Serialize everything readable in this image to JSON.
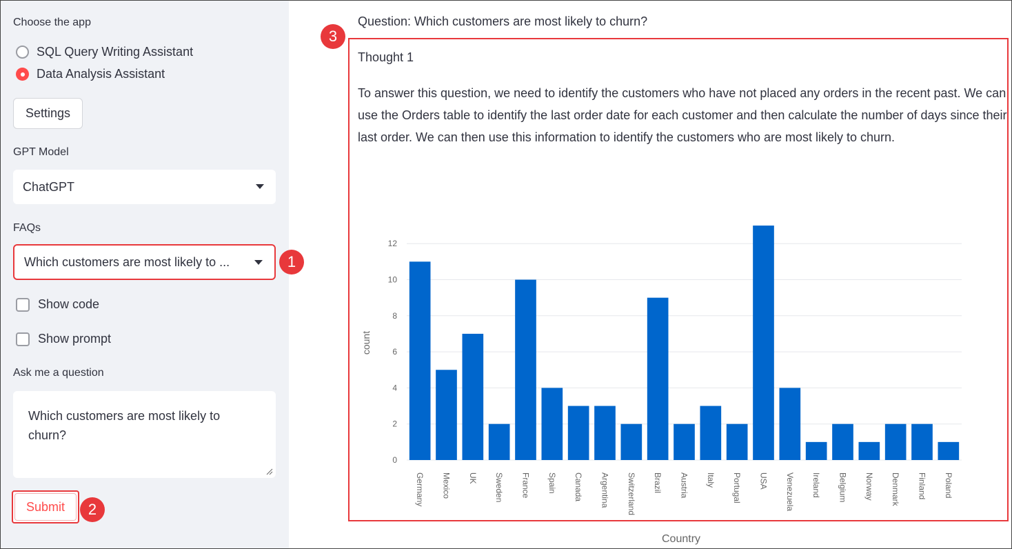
{
  "sidebar": {
    "choose_label": "Choose the app",
    "apps": [
      {
        "label": "SQL Query Writing Assistant",
        "selected": false
      },
      {
        "label": "Data Analysis Assistant",
        "selected": true
      }
    ],
    "settings_label": "Settings",
    "gpt_model_label": "GPT Model",
    "gpt_model_value": "ChatGPT",
    "faqs_label": "FAQs",
    "faqs_value": "Which customers are most likely to ...",
    "show_code_label": "Show code",
    "show_prompt_label": "Show prompt",
    "ask_label": "Ask me a question",
    "question_value": "Which customers are most likely to churn?",
    "submit_label": "Submit"
  },
  "callouts": [
    "1",
    "2",
    "3"
  ],
  "main": {
    "question": "Question: Which customers are most likely to churn?",
    "thought_title": "Thought 1",
    "thought_body": "To answer this question, we need to identify the customers who have not placed any orders in the recent past. We can use the Orders table to identify the last order date for each customer and then calculate the number of days since their last order. We can then use this information to identify the customers who are most likely to churn."
  },
  "colors": {
    "accent": "#ff4b4b",
    "highlight": "#e8383b",
    "bar": "#0066cc",
    "sidebar_bg": "#f0f2f6"
  },
  "chart_data": {
    "type": "bar",
    "categories": [
      "Germany",
      "Mexico",
      "UK",
      "Sweden",
      "France",
      "Spain",
      "Canada",
      "Argentina",
      "Switzerland",
      "Brazil",
      "Austria",
      "Italy",
      "Portugal",
      "USA",
      "Venezuela",
      "Ireland",
      "Belgium",
      "Norway",
      "Denmark",
      "Finland",
      "Poland"
    ],
    "values": [
      11,
      5,
      7,
      2,
      10,
      4,
      3,
      3,
      2,
      9,
      2,
      3,
      2,
      13,
      4,
      1,
      2,
      1,
      2,
      2,
      1
    ],
    "xlabel": "Country",
    "ylabel": "count",
    "ylim": [
      0,
      13.5
    ],
    "yticks": [
      0,
      2,
      4,
      6,
      8,
      10,
      12
    ],
    "grid": true
  }
}
